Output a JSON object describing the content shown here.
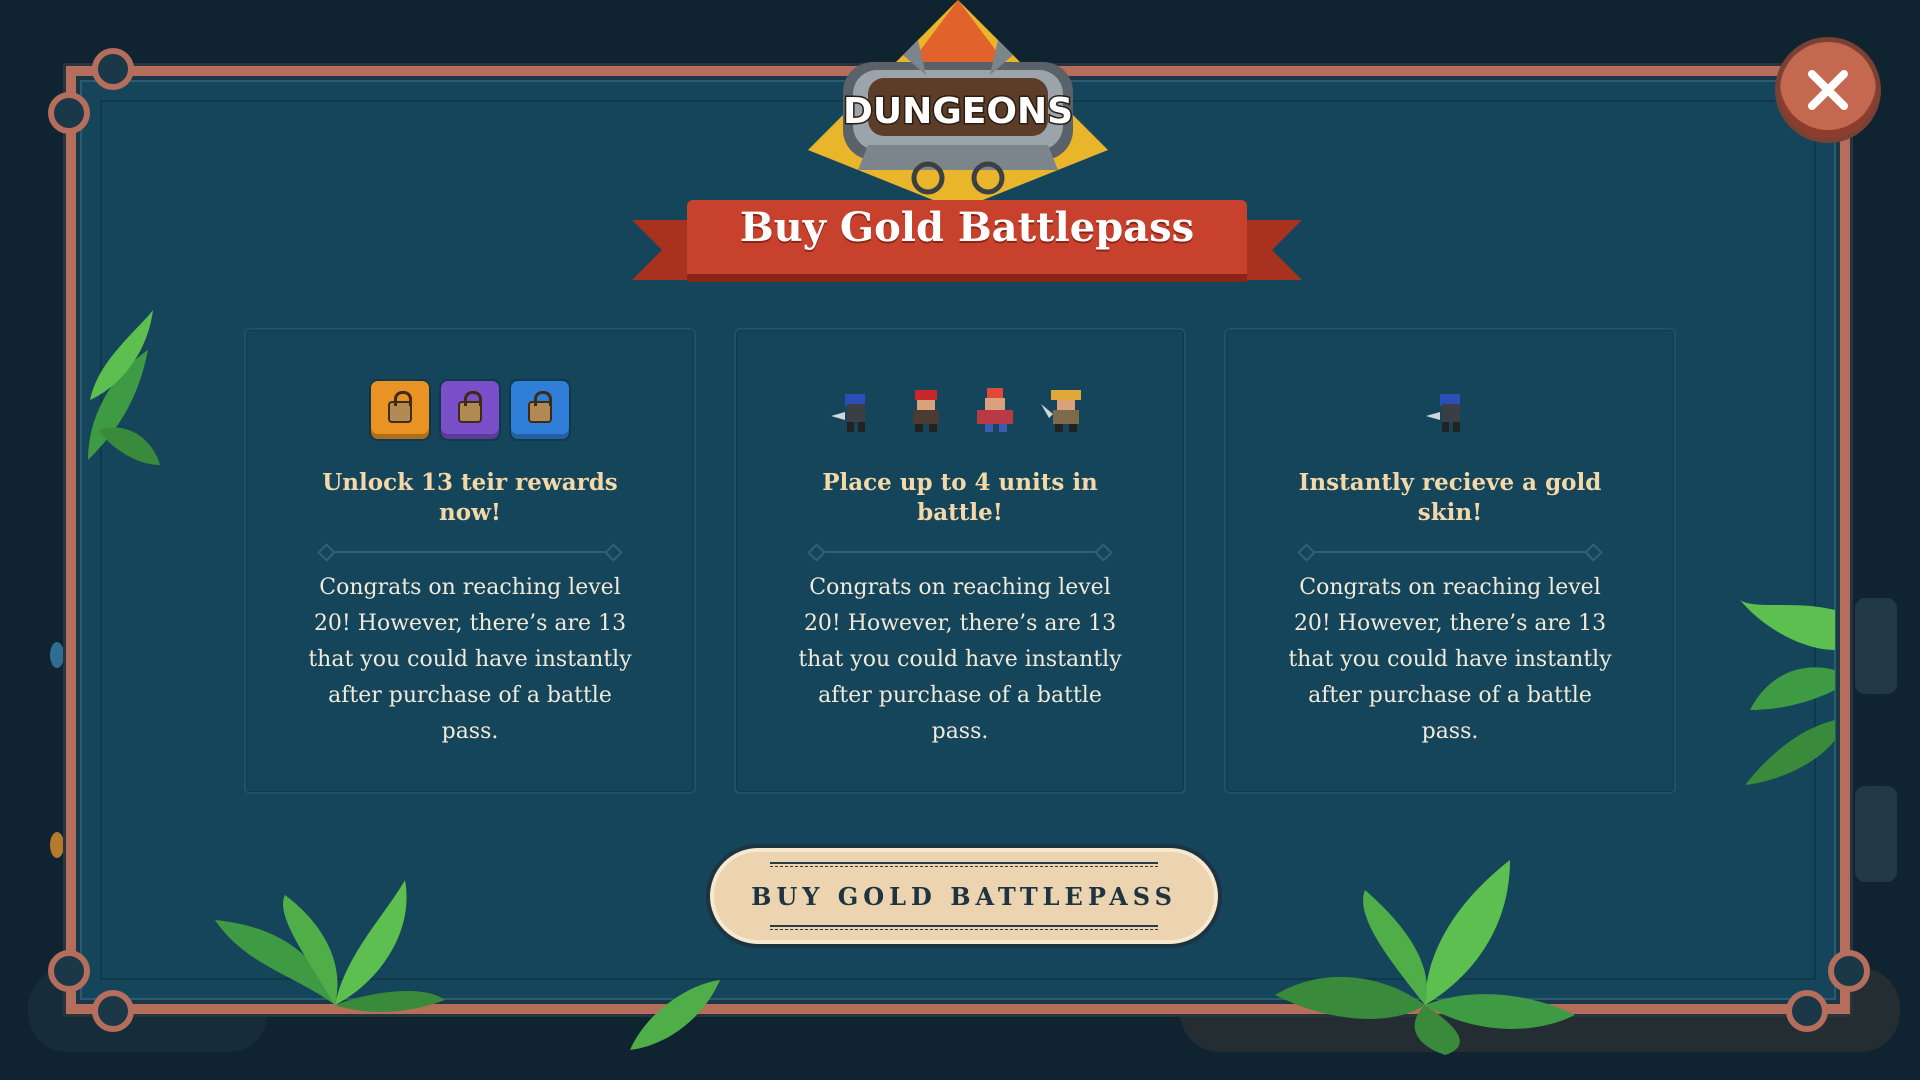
{
  "logo": {
    "text": "DUNGEONS"
  },
  "dialog": {
    "title": "Buy Gold Battlepass",
    "buy_button": "BUY GOLD BATTLEPASS"
  },
  "cards": [
    {
      "title": "Unlock 13  teir rewards now!",
      "body": "Congrats on reaching level 20! However, there’s are 13 that you could have instantly after purchase of a battle pass.",
      "icons": [
        "gold-tier-lock-icon",
        "purple-tier-lock-icon",
        "blue-tier-lock-icon"
      ]
    },
    {
      "title": "Place up to 4 units in battle!",
      "body": "Congrats on reaching level 20! However, there’s are 13 that you could have instantly after purchase of a battle pass.",
      "icons": [
        "knight-unit-icon",
        "pirate-unit-icon",
        "berserker-unit-icon",
        "captain-unit-icon"
      ]
    },
    {
      "title": "Instantly recieve a gold skin!",
      "body": "Congrats on reaching level 20! However, there’s are 13 that you could have instantly after purchase of a battle pass.",
      "icons": [
        "knight-unit-icon"
      ]
    }
  ],
  "colors": {
    "panel": "#15455a",
    "frame": "#b56e5b",
    "banner": "#c7412d",
    "button": "#ecd4b1",
    "title_text": "#f4d8a8"
  }
}
